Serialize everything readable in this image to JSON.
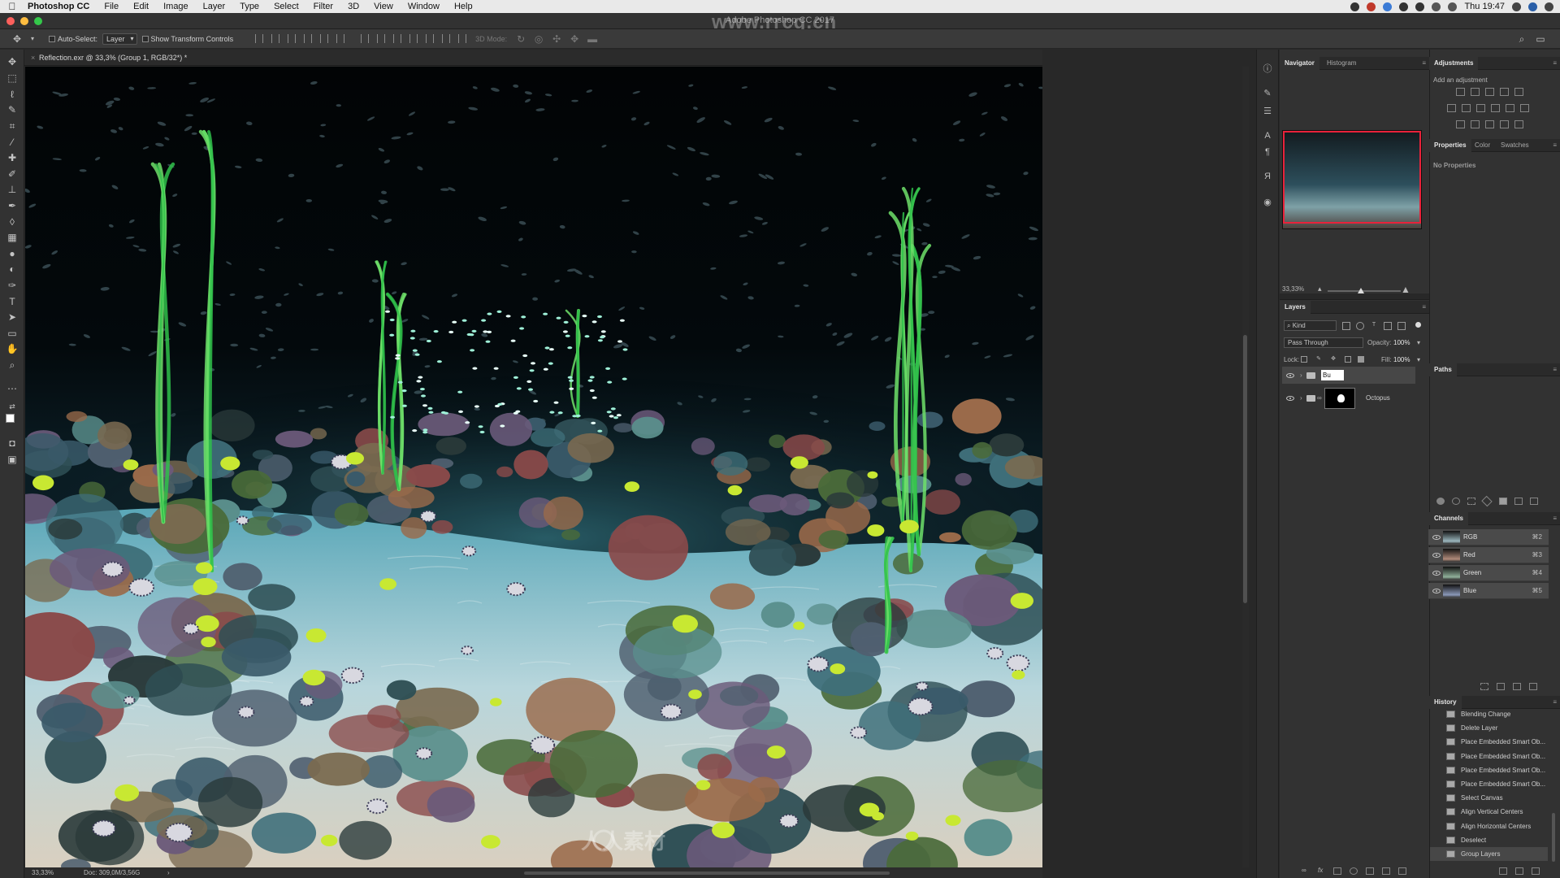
{
  "menubar": {
    "app_name": "Photoshop CC",
    "items": [
      "File",
      "Edit",
      "Image",
      "Layer",
      "Type",
      "Select",
      "Filter",
      "3D",
      "View",
      "Window",
      "Help"
    ],
    "clock": "Thu 19:47"
  },
  "window": {
    "title": "Adobe Photoshop CC 2017",
    "watermark": "www.rrcg.cn"
  },
  "options_bar": {
    "auto_select_label": "Auto-Select:",
    "auto_select_value": "Layer",
    "show_transform_label": "Show Transform Controls",
    "mode_3d_label": "3D Mode:"
  },
  "document": {
    "tab_title": "Reflection.exr @ 33,3% (Group 1, RGB/32*) *",
    "status_zoom": "33,33%",
    "status_doc": "Doc: 309,0M/3,56G",
    "canvas_watermark": "人人素材"
  },
  "navigator": {
    "tabs": [
      "Navigator",
      "Histogram"
    ],
    "zoom": "33,33%",
    "zoom_slider_fraction": 0.45,
    "view_rect_color": "#e8223a"
  },
  "adjustments": {
    "title": "Adjustments",
    "subtitle": "Add an adjustment"
  },
  "properties": {
    "tabs": [
      "Properties",
      "Color",
      "Swatches"
    ],
    "empty_text": "No Properties"
  },
  "layers": {
    "title": "Layers",
    "filter_kind": "Kind",
    "blend_mode": "Pass Through",
    "opacity_label": "Opacity:",
    "opacity_value": "100%",
    "lock_label": "Lock:",
    "fill_label": "Fill:",
    "fill_value": "100%",
    "items": [
      {
        "name": "Bu",
        "type": "group",
        "selected": true,
        "editing": true
      },
      {
        "name": "Octopus",
        "type": "group",
        "selected": false
      }
    ]
  },
  "paths": {
    "title": "Paths"
  },
  "channels": {
    "title": "Channels",
    "items": [
      {
        "name": "RGB",
        "shortcut": "⌘2"
      },
      {
        "name": "Red",
        "shortcut": "⌘3"
      },
      {
        "name": "Green",
        "shortcut": "⌘4"
      },
      {
        "name": "Blue",
        "shortcut": "⌘5"
      }
    ]
  },
  "history": {
    "title": "History",
    "items": [
      "Blending Change",
      "Delete Layer",
      "Place Embedded Smart Ob...",
      "Place Embedded Smart Ob...",
      "Place Embedded Smart Ob...",
      "Place Embedded Smart Ob...",
      "Select Canvas",
      "Align Vertical Centers",
      "Align Horizontal Centers",
      "Deselect",
      "Group Layers"
    ]
  },
  "colors": {
    "accent_red": "#e8223a",
    "panel_bg": "#323232",
    "canvas_bg": "#000000"
  }
}
